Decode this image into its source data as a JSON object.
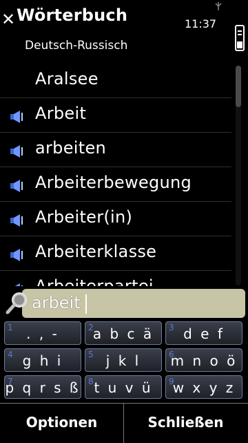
{
  "header": {
    "title": "Wörterbuch",
    "subtitle": "Deutsch-Russisch",
    "time": "11:37",
    "close_icon": "close-icon",
    "signal_icon": "signal-icon",
    "battery_icon": "battery-icon"
  },
  "list": {
    "items": [
      {
        "word": "Aralsee",
        "speaker": false
      },
      {
        "word": "Arbeit",
        "speaker": true
      },
      {
        "word": "arbeiten",
        "speaker": true
      },
      {
        "word": "Arbeiterbewegung",
        "speaker": true
      },
      {
        "word": "Arbeiter(in)",
        "speaker": true
      },
      {
        "word": "Arbeiterklasse",
        "speaker": true
      },
      {
        "word": "Arbeiterpartei",
        "speaker": true
      }
    ]
  },
  "search": {
    "value": "arbeit",
    "icon": "search-icon"
  },
  "keypad": {
    "keys": [
      {
        "num": "1",
        "letters": ". , -"
      },
      {
        "num": "2",
        "letters": "a b c ä"
      },
      {
        "num": "3",
        "letters": "d e f"
      },
      {
        "num": "4",
        "letters": "g h i"
      },
      {
        "num": "5",
        "letters": "j k l"
      },
      {
        "num": "6",
        "letters": "m n o ö"
      },
      {
        "num": "7",
        "letters": "p q r s ß"
      },
      {
        "num": "8",
        "letters": "t u v ü"
      },
      {
        "num": "9",
        "letters": "w x y z"
      }
    ]
  },
  "softkeys": {
    "left": "Optionen",
    "right": "Schließen"
  }
}
